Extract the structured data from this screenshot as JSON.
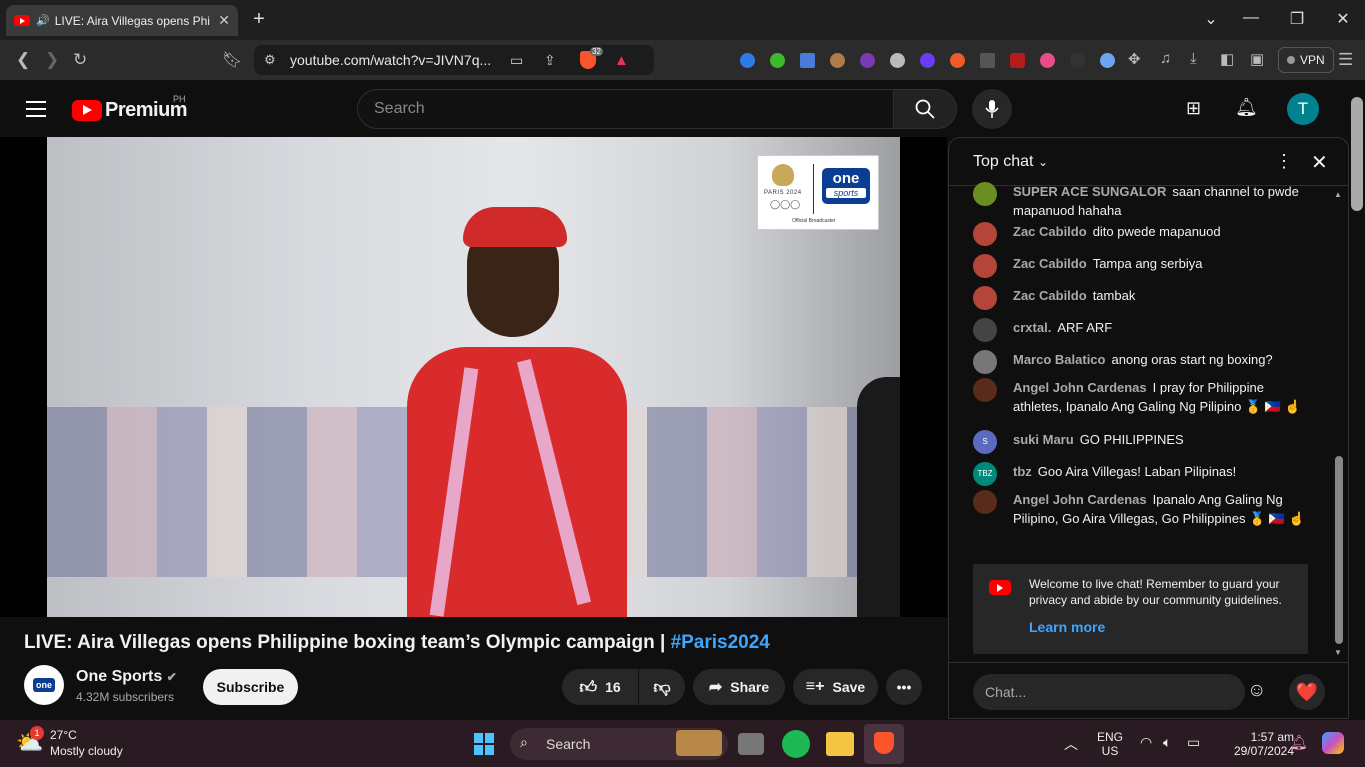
{
  "browser": {
    "tab_title": "LIVE: Aira Villegas opens Phi",
    "url": "youtube.com/watch?v=JIVN7q...",
    "vpn_label": "VPN",
    "shield_badge": "32"
  },
  "youtube": {
    "logo_text": "Premium",
    "country_code": "PH",
    "search_placeholder": "Search",
    "avatar_letter": "T"
  },
  "video": {
    "broadcaster_badge": {
      "event": "PARIS 2024",
      "brand_top": "one",
      "brand_bottom": "sports",
      "caption": "Official Broadcaster"
    },
    "title": "LIVE: Aira Villegas opens Philippine boxing team’s Olympic campaign | ",
    "hashtag": "#Paris2024",
    "channel_logo_text": "one",
    "channel_name": "One Sports",
    "subscribers": "4.32M subscribers",
    "subscribe_label": "Subscribe",
    "like_count": "16",
    "share_label": "Share",
    "save_label": "Save"
  },
  "chat": {
    "header": "Top chat",
    "messages": [
      {
        "author": "SUPER ACE SUNGALOR",
        "text": "saan channel to pwde mapanuod hahaha",
        "color": "#6b8e23"
      },
      {
        "author": "Zac Cabildo",
        "text": "dito pwede mapanuod",
        "color": "#b5443a"
      },
      {
        "author": "Zac Cabildo",
        "text": "Tampa ang serbiya",
        "color": "#b5443a"
      },
      {
        "author": "Zac Cabildo",
        "text": "tambak",
        "color": "#b5443a"
      },
      {
        "author": "crxtal.",
        "text": "ARF ARF",
        "color": "#444444"
      },
      {
        "author": "Marco Balatico",
        "text": "anong oras start ng boxing?",
        "color": "#777777"
      },
      {
        "author": "Angel John Cardenas",
        "text": "I pray for Philippine athletes, Ipanalo Ang Galing Ng Pilipino 🥇 🇵🇭 ☝",
        "color": "#5a2a1a"
      },
      {
        "author": "suki Maru",
        "text": "GO PHILIPPINES",
        "color": "#5c6bc0",
        "initial": "S"
      },
      {
        "author": "tbz",
        "text": "Goo Aira Villegas! Laban Pilipinas!",
        "color": "#00897b",
        "initial": "TBZ"
      },
      {
        "author": "Angel John Cardenas",
        "text": "Ipanalo Ang Galing Ng Pilipino, Go Aira Villegas, Go Philippines 🥇 🇵🇭 ☝",
        "color": "#5a2a1a"
      }
    ],
    "welcome_text": "Welcome to live chat! Remember to guard your privacy and abide by our community guidelines.",
    "learn_more": "Learn more",
    "input_placeholder": "Chat...",
    "heart": "❤️"
  },
  "taskbar": {
    "weather_temp": "27°C",
    "weather_desc": "Mostly cloudy",
    "weather_badge": "1",
    "search_label": "Search",
    "lang_top": "ENG",
    "lang_bottom": "US",
    "time": "1:57 am",
    "date": "29/07/2024"
  }
}
